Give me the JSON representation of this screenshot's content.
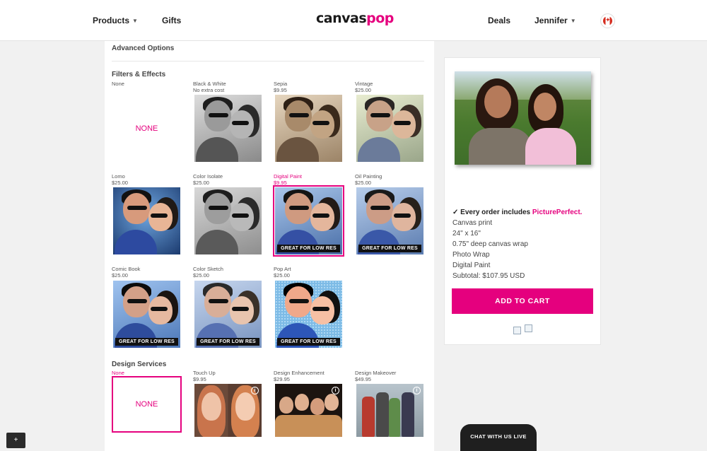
{
  "header": {
    "products": "Products",
    "gifts": "Gifts",
    "logo_a": "canvas",
    "logo_b": "pop",
    "deals": "Deals",
    "user": "Jennifer",
    "flag_icon": "canada-flag-icon"
  },
  "advanced_options": "Advanced Options",
  "filters": {
    "title": "Filters & Effects",
    "items": [
      {
        "name": "None",
        "price": "",
        "none_text": "NONE"
      },
      {
        "name": "Black & White",
        "price": "No extra cost"
      },
      {
        "name": "Sepia",
        "price": "$9.95"
      },
      {
        "name": "Vintage",
        "price": "$25.00"
      },
      {
        "name": "Lomo",
        "price": "$25.00"
      },
      {
        "name": "Color Isolate",
        "price": "$25.00"
      },
      {
        "name": "Digital Paint",
        "price": "$9.95"
      },
      {
        "name": "Oil Painting",
        "price": "$25.00"
      },
      {
        "name": "Comic Book",
        "price": "$25.00"
      },
      {
        "name": "Color Sketch",
        "price": "$25.00"
      },
      {
        "name": "Pop Art",
        "price": "$25.00"
      }
    ],
    "badge": "GREAT FOR LOW RES",
    "selected": "Digital Paint"
  },
  "design_services": {
    "title": "Design Services",
    "items": [
      {
        "name": "None",
        "price": "",
        "none_text": "NONE"
      },
      {
        "name": "Touch Up",
        "price": "$9.95"
      },
      {
        "name": "Design Enhancement",
        "price": "$29.95"
      },
      {
        "name": "Design Makeover",
        "price": "$49.95"
      }
    ]
  },
  "order": {
    "includes_prefix": "✓ Every order includes ",
    "includes_brand": "PicturePerfect.",
    "lines": [
      "Canvas print",
      "24\" x 16\"",
      "0.75\" deep canvas wrap",
      "Photo Wrap",
      "Digital Paint",
      "Subtotal: $107.95 USD"
    ],
    "add_to_cart": "ADD TO CART"
  },
  "chat": "CHAT WITH US LIVE",
  "plus": "+",
  "colors": {
    "accent": "#e5007e"
  }
}
